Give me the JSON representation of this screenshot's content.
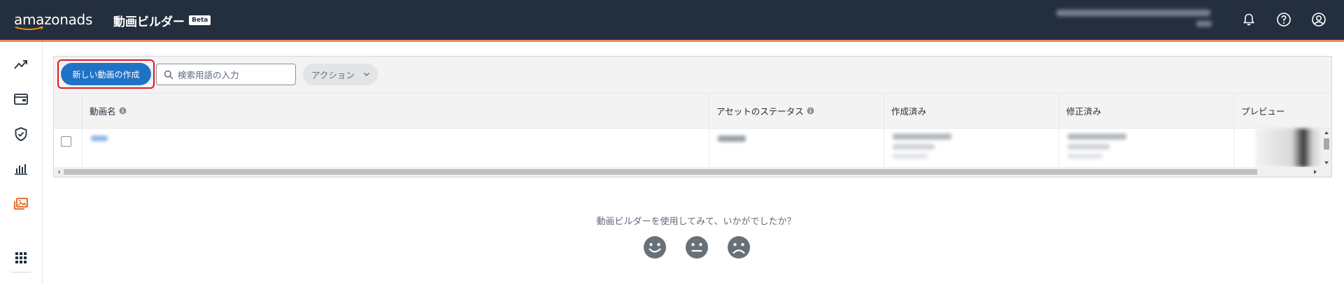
{
  "app": {
    "logo_text": "amazonads",
    "title": "動画ビルダー",
    "badge": "Beta"
  },
  "header": {
    "icons": [
      "bell-icon",
      "help-icon",
      "account-icon"
    ]
  },
  "sidebar": {
    "items": [
      {
        "icon": "trending-icon",
        "active": false
      },
      {
        "icon": "wallet-icon",
        "active": false
      },
      {
        "icon": "shield-check-icon",
        "active": false
      },
      {
        "icon": "bar-chart-icon",
        "active": false
      },
      {
        "icon": "media-library-icon",
        "active": true
      },
      {
        "icon": "apps-grid-icon",
        "active": false
      }
    ]
  },
  "toolbar": {
    "create_label": "新しい動画の作成",
    "search_placeholder": "検索用語の入力",
    "actions_label": "アクション"
  },
  "table": {
    "columns": [
      "動画名",
      "アセットのステータス",
      "作成済み",
      "修正済み",
      "プレビュー"
    ]
  },
  "feedback": {
    "question": "動画ビルダーを使用してみて、いかがでしたか？",
    "options": [
      "happy-face-icon",
      "neutral-face-icon",
      "sad-face-icon"
    ]
  },
  "colors": {
    "header_bg": "#232f3e",
    "accent": "#f0855a",
    "primary_button": "#1f73c7",
    "highlight": "#e0191e",
    "active_nav": "#e15d16"
  }
}
